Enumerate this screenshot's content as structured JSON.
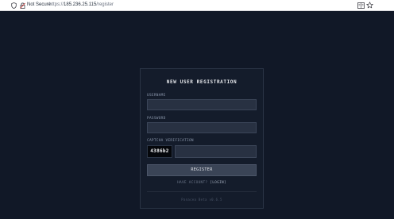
{
  "browser": {
    "security_label": "Not Secure",
    "url_scheme": "https://",
    "url_host": "185.236.25.115",
    "url_path": "/register",
    "icons": [
      "shield-icon",
      "lock-broken-icon",
      "reader-view-icon",
      "star-icon"
    ]
  },
  "form": {
    "title": "NEW USER REGISTRATION",
    "username_label": "USERNAME",
    "username_value": "",
    "password_label": "PASSWORD",
    "password_value": "",
    "captcha_label": "CAPTCHA VERIFICATION",
    "captcha_code": "4386b2",
    "captcha_value": "",
    "register_label": "REGISTER",
    "login_prompt": "HAVE ACCOUNT?",
    "login_link": "[LOGIN]",
    "version": "Panacea Beta v0.6.5"
  },
  "colors": {
    "page_bg": "#111827",
    "card_bg": "#141c2b",
    "input_bg": "#283142",
    "button_bg": "#3a4456"
  }
}
